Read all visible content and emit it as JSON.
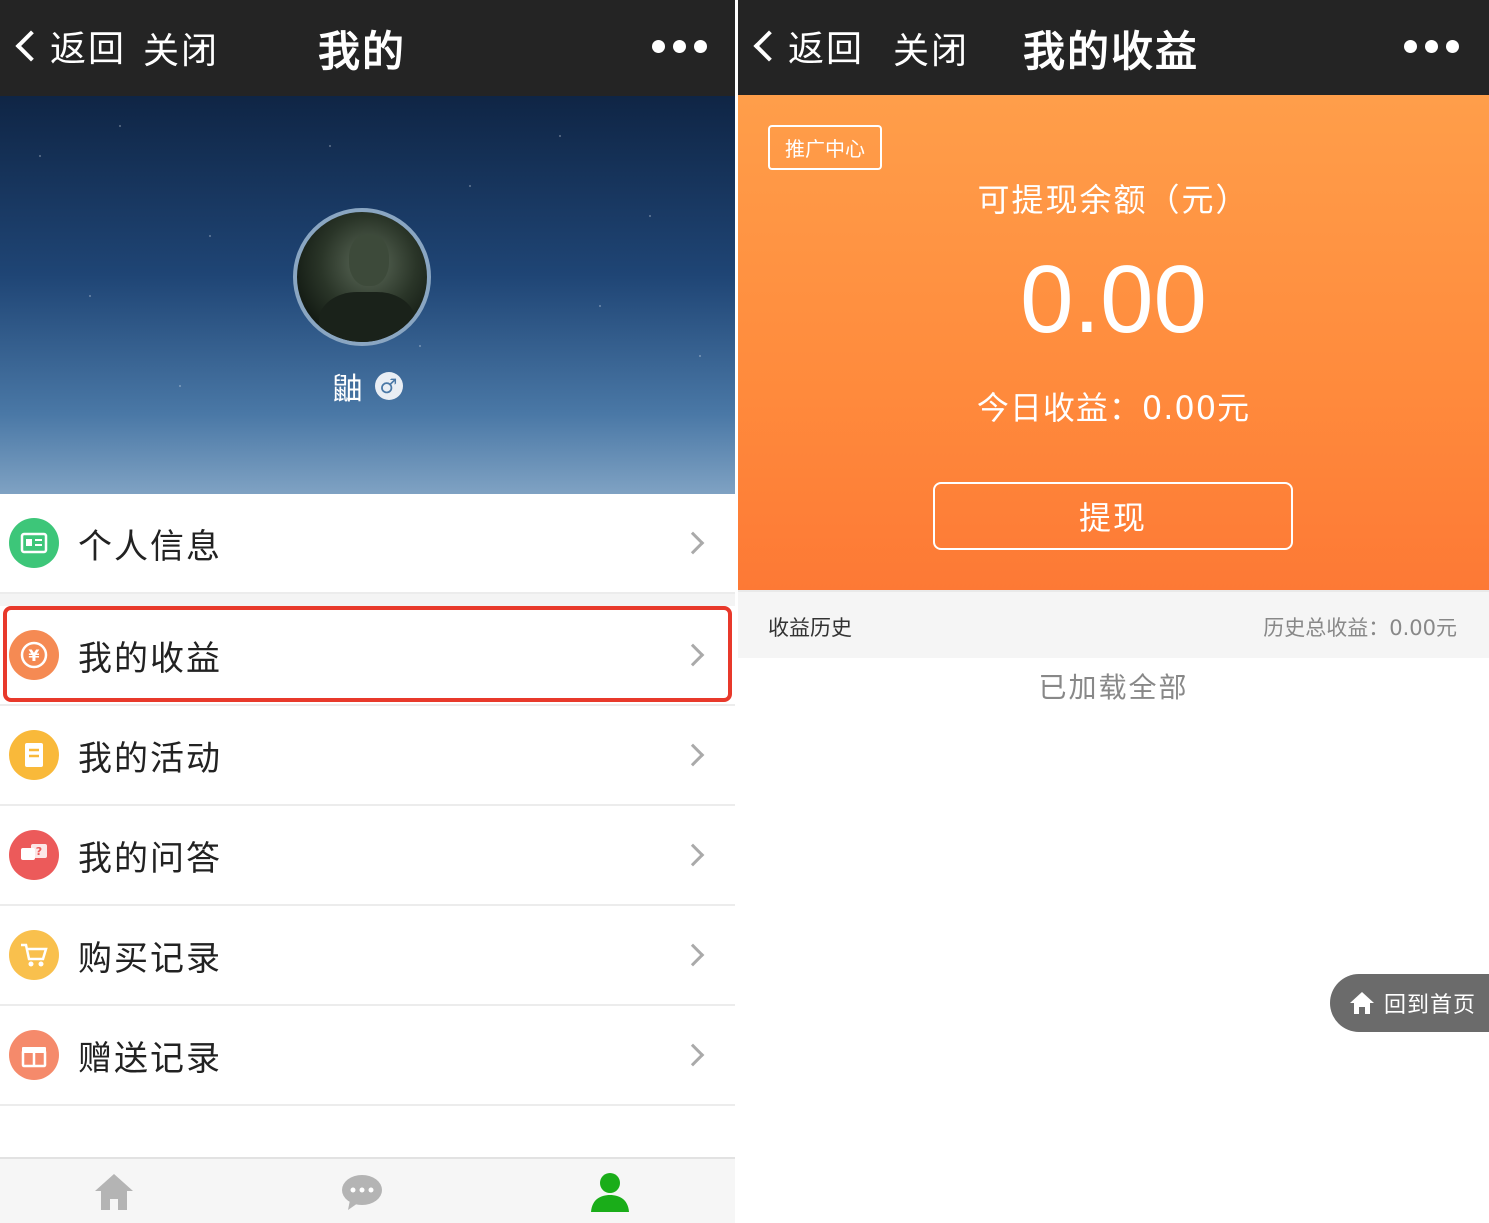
{
  "left": {
    "nav": {
      "back_label": "返回",
      "close_label": "关闭",
      "title": "我的"
    },
    "profile": {
      "username": "鼬",
      "gender_symbol": "♂"
    },
    "menu": [
      {
        "label": "个人信息",
        "icon": "id-card-icon",
        "color": "#3dc679"
      },
      {
        "label": "我的收益",
        "icon": "yuan-coin-icon",
        "color": "#f58a53"
      },
      {
        "label": "我的活动",
        "icon": "activity-list-icon",
        "color": "#f9b93a"
      },
      {
        "label": "我的问答",
        "icon": "qa-bubble-icon",
        "color": "#ec5a5a"
      },
      {
        "label": "购买记录",
        "icon": "shopping-cart-icon",
        "color": "#f9c04d"
      },
      {
        "label": "赠送记录",
        "icon": "gift-box-icon",
        "color": "#f58a6b"
      }
    ],
    "highlighted_item": "我的收益",
    "tabbar": [
      {
        "icon": "home-icon",
        "active": false
      },
      {
        "icon": "chat-icon",
        "active": false
      },
      {
        "icon": "user-icon",
        "active": true,
        "color": "#1aad19"
      }
    ]
  },
  "right": {
    "nav": {
      "back_label": "返回",
      "close_label": "关闭",
      "title": "我的收益"
    },
    "promo_tag": "推广中心",
    "balance_label": "可提现余额（元）",
    "balance_value": "0.00",
    "today_earnings": "今日收益：0.00元",
    "withdraw_label": "提现",
    "history_title": "收益历史",
    "history_total": "历史总收益：0.00元",
    "loaded_all": "已加载全部",
    "home_button": "回到首页"
  },
  "colors": {
    "navbar_bg": "#242424",
    "earn_orange": "#ff8a3c",
    "highlight_red": "#e8392b"
  }
}
